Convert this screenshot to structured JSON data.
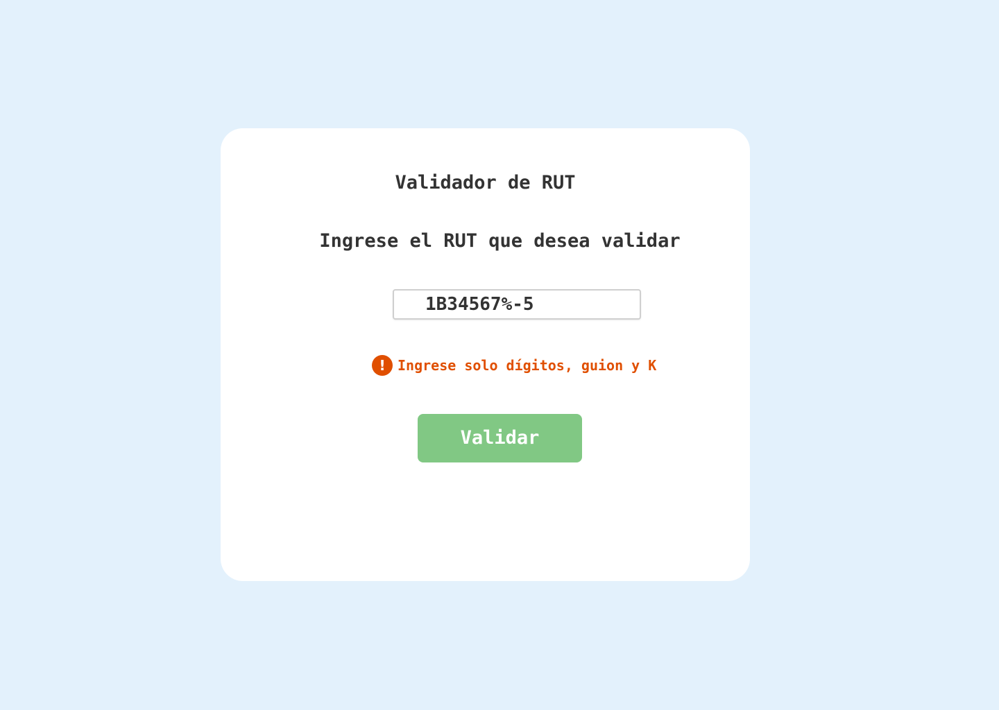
{
  "card": {
    "title": "Validador de RUT",
    "prompt": "Ingrese el RUT que desea validar"
  },
  "rut_input": {
    "value": "1B34567%-5",
    "placeholder": ""
  },
  "error": {
    "icon": "exclamation-icon",
    "icon_glyph": "!",
    "message": "Ingrese solo dígitos, guion y K",
    "color": "#e04f00"
  },
  "validate_button": {
    "label": "Validar",
    "color": "#81c884"
  },
  "colors": {
    "page_background": "#e3f1fc",
    "card_background": "#ffffff",
    "text": "#333333"
  }
}
